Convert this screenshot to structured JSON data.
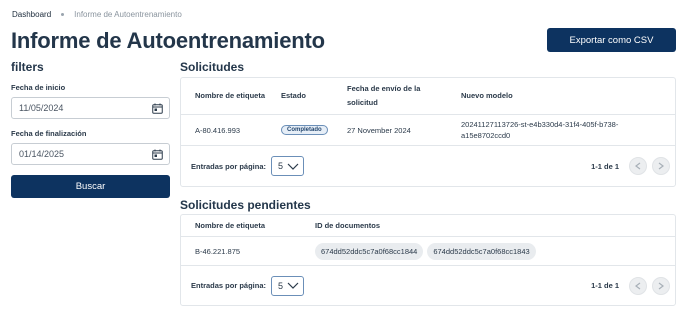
{
  "breadcrumb": {
    "home": "Dashboard",
    "current": "Informe de Autoentrenamiento"
  },
  "page_title": "Informe de Autoentrenamiento",
  "export_button": "Exportar como CSV",
  "filters": {
    "title": "filters",
    "start_label": "Fecha de inicio",
    "start_value": "11/05/2024",
    "end_label": "Fecha de finalización",
    "end_value": "01/14/2025",
    "search_button": "Buscar"
  },
  "requests": {
    "title": "Solicitudes",
    "columns": {
      "label": "Nombre de etiqueta",
      "status": "Estado",
      "date": "Fecha de envío de la solicitud",
      "model": "Nuevo modelo"
    },
    "rows": [
      {
        "label": "A-80.416.993",
        "status": "Completado",
        "date": "27 November 2024",
        "model": "20241127113726-st-e4b330d4-31f4-405f-b738-a15e8702ccd0"
      }
    ],
    "pager": {
      "per_page_label": "Entradas por página:",
      "per_page_value": "5",
      "range": "1-1 de 1"
    }
  },
  "pending": {
    "title": "Solicitudes pendientes",
    "columns": {
      "label": "Nombre de etiqueta",
      "docs": "ID de documentos"
    },
    "rows": [
      {
        "label": "B-46.221.875",
        "docs": [
          "674dd52ddc5c7a0f68cc1844",
          "674dd52ddc5c7a0f68cc1843"
        ]
      }
    ],
    "pager": {
      "per_page_label": "Entradas por página:",
      "per_page_value": "5",
      "range": "1-1 de 1"
    }
  },
  "colors": {
    "primary": "#0d3360",
    "title": "#23364a",
    "badge_border": "#6b8fb8"
  },
  "icons": {
    "date_field": "calendar-icon",
    "per_page": "chevron-down-icon",
    "prev": "chevron-left-icon",
    "next": "chevron-right-icon"
  }
}
